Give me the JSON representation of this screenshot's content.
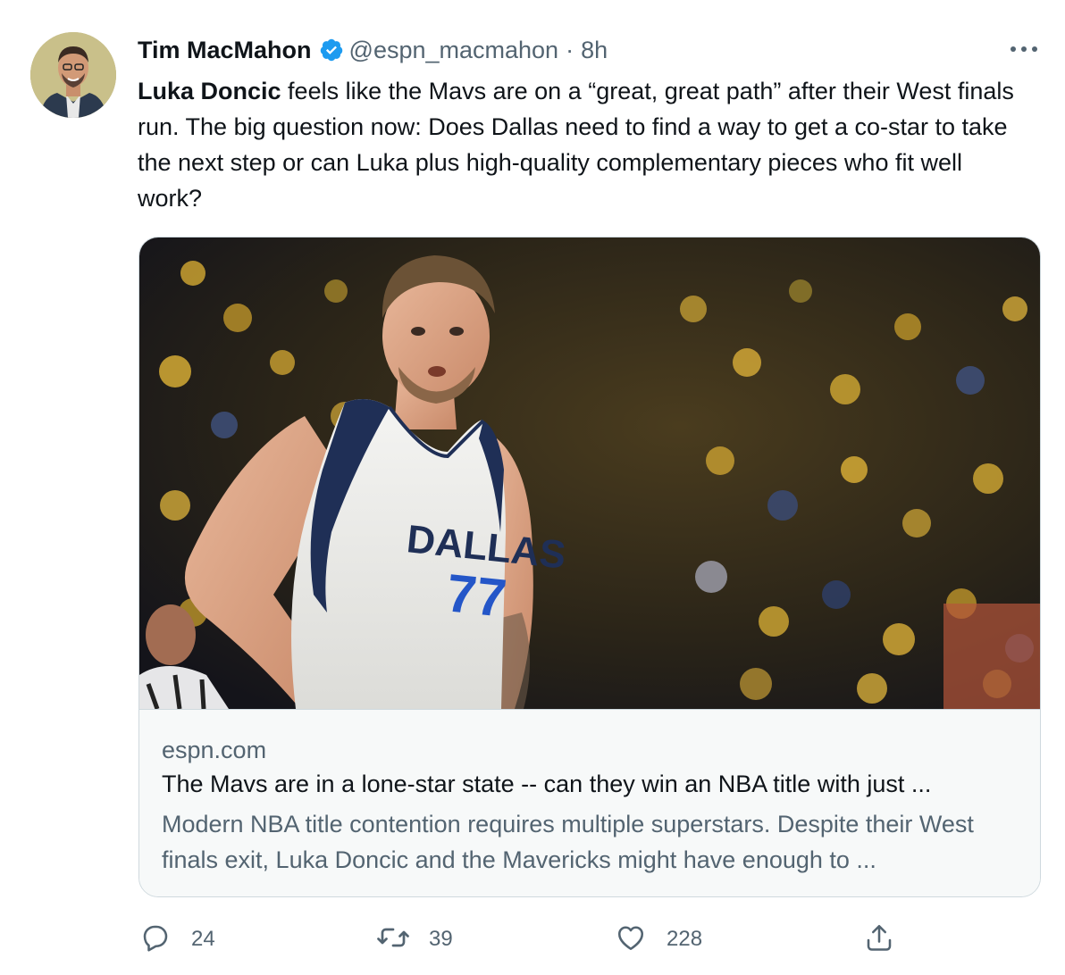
{
  "tweet": {
    "author_name": "Tim MacMahon",
    "verified": true,
    "handle": "@espn_macmahon",
    "separator": "·",
    "time": "8h",
    "text_mention": "Luka Doncic",
    "text_body": " feels like the Mavs are on a “great, great path” after their West finals run. The big question now: Does Dallas need to find a way to get a co-star to take the next step or can Luka plus high-quality complementary pieces who fit well work?"
  },
  "card": {
    "image_jersey_text": "DALLAS",
    "image_jersey_number": "77",
    "domain": "espn.com",
    "title": "The Mavs are in a lone-star state -- can they win an NBA title with just ...",
    "description": "Modern NBA title contention requires multiple superstars. Despite their West finals exit, Luka Doncic and the Mavericks might have enough to ..."
  },
  "actions": {
    "reply_count": "24",
    "retweet_count": "39",
    "like_count": "228"
  },
  "colors": {
    "verified_badge": "#1d9bf0",
    "secondary_text": "#536471",
    "primary_text": "#0f1419",
    "card_border": "#cfd9de"
  },
  "icons": [
    "verified-badge-icon",
    "more-icon",
    "reply-icon",
    "retweet-icon",
    "like-icon",
    "share-icon"
  ]
}
